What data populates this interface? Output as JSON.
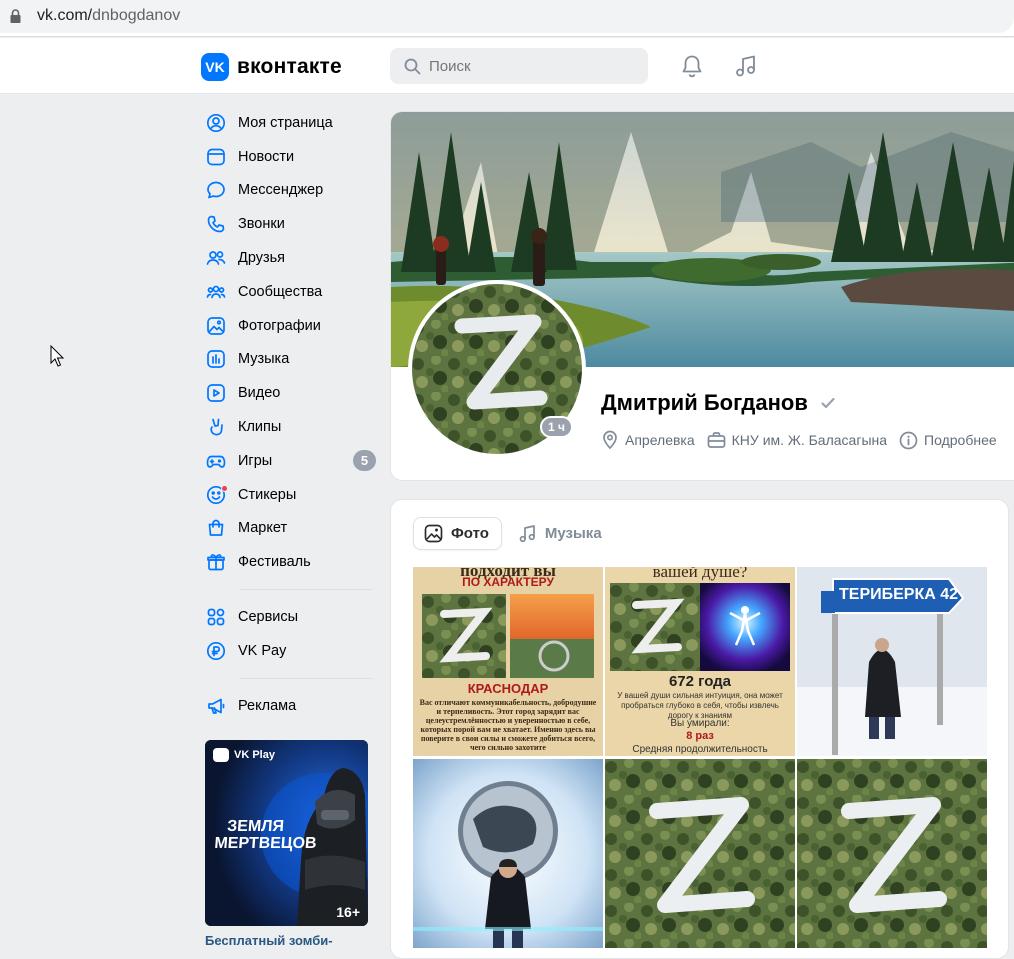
{
  "browser": {
    "url_domain": "vk.com/",
    "url_path": "dnbogdanov"
  },
  "header": {
    "logo_text": "вконтакте",
    "logo_mark": "VK",
    "search_placeholder": "Поиск",
    "accent": "#0077ff"
  },
  "sidebar": {
    "items": [
      {
        "label": "Моя страница",
        "icon": "user-circle-icon"
      },
      {
        "label": "Новости",
        "icon": "news-icon"
      },
      {
        "label": "Мессенджер",
        "icon": "message-icon"
      },
      {
        "label": "Звонки",
        "icon": "phone-icon"
      },
      {
        "label": "Друзья",
        "icon": "friends-icon"
      },
      {
        "label": "Сообщества",
        "icon": "communities-icon"
      },
      {
        "label": "Фотографии",
        "icon": "photo-icon"
      },
      {
        "label": "Музыка",
        "icon": "music-icon"
      },
      {
        "label": "Видео",
        "icon": "video-icon"
      },
      {
        "label": "Клипы",
        "icon": "clips-icon"
      },
      {
        "label": "Игры",
        "icon": "games-icon",
        "badge": "5"
      },
      {
        "label": "Стикеры",
        "icon": "stickers-icon"
      },
      {
        "label": "Маркет",
        "icon": "market-icon"
      },
      {
        "label": "Фестиваль",
        "icon": "gift-icon"
      }
    ],
    "secondary": [
      {
        "label": "Сервисы",
        "icon": "services-icon"
      },
      {
        "label": "VK Pay",
        "icon": "vkpay-icon"
      }
    ],
    "tertiary": [
      {
        "label": "Реклама",
        "icon": "megaphone-icon"
      }
    ],
    "ad": {
      "brand": "VK Play",
      "title": "ЗЕМЛЯ МЕРТВЕЦОВ",
      "age": "16+",
      "caption": "Бесплатный зомби-"
    }
  },
  "profile": {
    "name": "Дмитрий Богданов",
    "last_seen": "1 ч",
    "location": "Апрелевка",
    "education": "КНУ им. Ж. Баласагына",
    "more": "Подробнее"
  },
  "media": {
    "tabs": [
      {
        "label": "Фото",
        "active": true
      },
      {
        "label": "Музыка",
        "active": false
      }
    ],
    "card1": {
      "top": "подходит вы",
      "sub": "ПО ХАРАКТЕРУ",
      "city": "КРАСНОДАР",
      "text": "Вас отличают коммуникабельность, добродушие и терпеливость. Этот город зарядит вас целеустремлённостью и уверенностью в себе, которых порой вам не хватает. Именно здесь вы поверите в свои силы и сможете добиться всего, чего сильно захотите"
    },
    "card2": {
      "top": "вашей душе?",
      "years": "672 года",
      "text": "У вашей души сильная интуиция, она может пробраться глубоко в себя, чтобы извлечь дорогу к знаниям",
      "died_label": "Вы умирали:",
      "died": "8 раз",
      "bottom": "Средняя продолжительность"
    },
    "sign": "ТЕРИБЕРКА 42"
  }
}
